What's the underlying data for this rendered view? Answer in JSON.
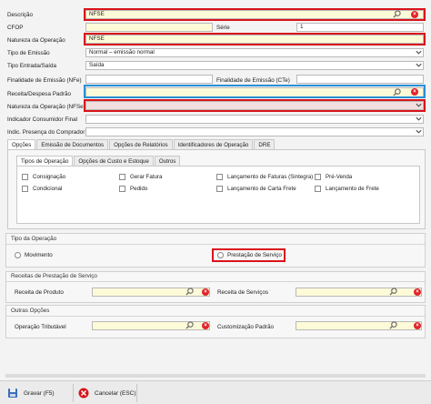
{
  "form": {
    "descricao_label": "Descrição",
    "descricao_value": "NFSE",
    "cfop_label": "CFOP",
    "serie_label": "Série",
    "serie_value": "1",
    "natureza_label": "Natureza da Operação",
    "natureza_value": "NFSE",
    "tipo_emissao_label": "Tipo de Emissão",
    "tipo_emissao_value": "Normal – emissão normal",
    "tipo_entrada_label": "Tipo Entrada/Saída",
    "tipo_entrada_value": "Saída",
    "finalidade_nfe_label": "Finalidade de Emissão (NFe)",
    "finalidade_cte_label": "Finalidade de Emissão (CTe)",
    "receita_label": "Receita/Despesa Padrão",
    "natureza_nfse_label": "Natureza da Operação (NFSe)",
    "indicador_label": "Indicador Consumidor Final",
    "presenca_label": "Indic. Presença do Comprador"
  },
  "tabs": [
    "Opções",
    "Emissão de Documentos",
    "Opções de Relatórios",
    "Identificadores de Operação",
    "DRE"
  ],
  "subtabs": [
    "Tipos de Operação",
    "Opções de Custo e Estoque",
    "Outros"
  ],
  "checkboxes": {
    "consignacao": "Consignação",
    "gerar_fatura": "Gerar Fatura",
    "lanc_faturas": "Lançamento de Faturas (Sintegra)",
    "pre_venda": "Pré-Venda",
    "condicional": "Condicional",
    "pedido": "Pedido",
    "lanc_carta": "Lançamento de Carta Frete",
    "lanc_frete": "Lançamento de Frete"
  },
  "tipo_operacao": {
    "title": "Tipo da Operação",
    "movimento": "Movimento",
    "prestacao": "Prestação de Serviço"
  },
  "receitas": {
    "title": "Receitas de Prestação de Serviço",
    "produto_label": "Receita de Produto",
    "servicos_label": "Receita de Serviços"
  },
  "outras": {
    "title": "Outras Opções",
    "tributavel_label": "Operação Tributável",
    "customizacao_label": "Customização Padrão"
  },
  "footer": {
    "gravar": "Gravar (F5)",
    "cancelar": "Cancelar (ESC)"
  },
  "colors": {
    "highlight_red": "#d9141b",
    "highlight_blue": "#2a8fd6",
    "required_yellow": "#fdfad8"
  }
}
